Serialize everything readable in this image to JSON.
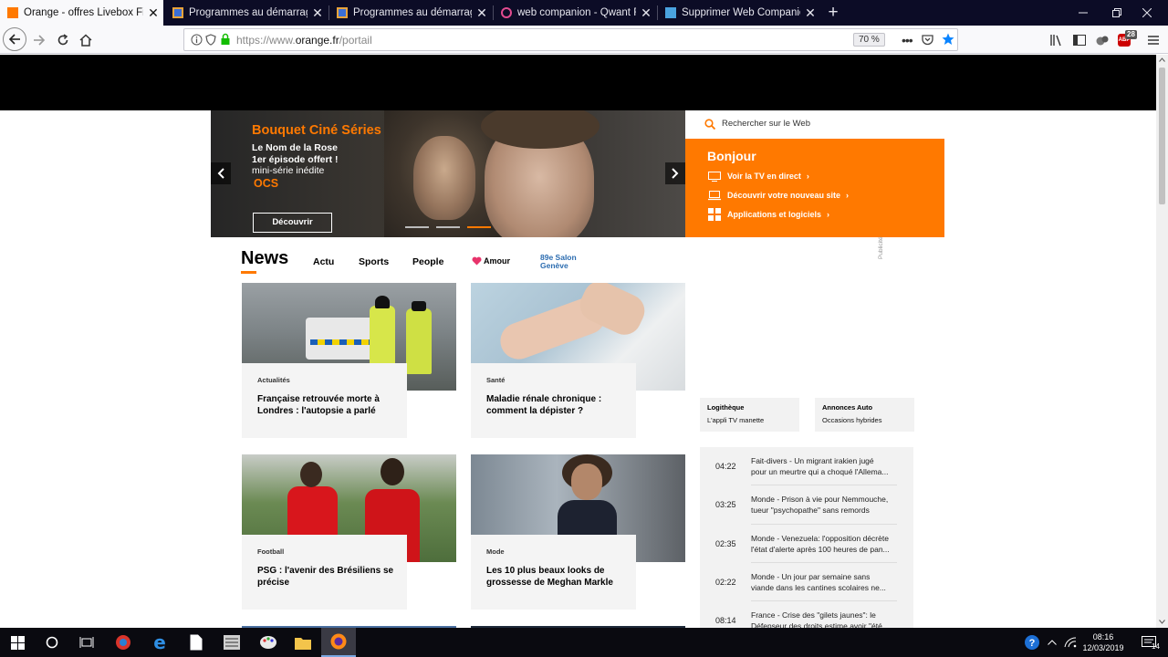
{
  "browser": {
    "tabs": [
      {
        "title": "Orange - offres Livebox Fibre et",
        "active": true,
        "favicon": "orange-logo-icon"
      },
      {
        "title": "Programmes au démarrage du",
        "active": false,
        "favicon": "app-icon"
      },
      {
        "title": "Programmes au démarrage du",
        "active": false,
        "favicon": "app-icon"
      },
      {
        "title": "web companion - Qwant Reche",
        "active": false,
        "favicon": "qwant-icon"
      },
      {
        "title": "Supprimer Web Companion - C",
        "active": false,
        "favicon": "bookmark-icon"
      }
    ],
    "url_prefix": "https://www.",
    "url_host": "orange.fr",
    "url_path": "/portail",
    "zoom": "70 %",
    "badge_count": "28",
    "badge_label": "ABP"
  },
  "hero": {
    "title": "Bouquet Ciné Séries",
    "line1": "Le Nom de la Rose",
    "line2": "1er épisode offert !",
    "line3": "mini-série inédite",
    "logo": "OCS",
    "button": "Découvrir",
    "active_slide": 3
  },
  "search": {
    "placeholder": "Rechercher sur le Web"
  },
  "bonjour": {
    "title": "Bonjour",
    "links": [
      {
        "label": "Voir la TV en direct",
        "icon": "tv-icon"
      },
      {
        "label": "Découvrir votre nouveau site",
        "icon": "laptop-icon"
      },
      {
        "label": "Applications et logiciels",
        "icon": "apps-grid-icon"
      }
    ]
  },
  "news": {
    "title": "News",
    "nav": [
      "Actu",
      "Sports",
      "People",
      "Amour"
    ],
    "salon_label_top": "89e Salon",
    "salon_label_bottom": "Genève",
    "cards": [
      {
        "category": "Actualités",
        "title": "Française retrouvée morte à Londres : l'autopsie a parlé"
      },
      {
        "category": "Santé",
        "title": "Maladie rénale chronique : comment la dépister ?"
      },
      {
        "category": "Football",
        "title": "PSG : l'avenir des Brésiliens se précise"
      },
      {
        "category": "Mode",
        "title": "Les 10 plus beaux looks de grossesse de Meghan Markle"
      }
    ]
  },
  "ad_label": "Publicité",
  "promos": [
    {
      "title": "Logithèque",
      "subtitle": "L'appli TV manette"
    },
    {
      "title": "Annonces Auto",
      "subtitle": "Occasions hybrides"
    }
  ],
  "flash": [
    {
      "time": "04:22",
      "line1": "Fait-divers - Un migrant irakien jugé",
      "line2": "pour un meurtre qui a choqué l'Allema..."
    },
    {
      "time": "03:25",
      "line1": "Monde - Prison à vie pour Nemmouche,",
      "line2": "tueur \"psychopathe\" sans remords"
    },
    {
      "time": "02:35",
      "line1": "Monde - Venezuela: l'opposition décrète",
      "line2": "l'état d'alerte après 100 heures de pan..."
    },
    {
      "time": "02:22",
      "line1": "Monde - Un jour par semaine sans",
      "line2": "viande dans les cantines scolaires ne..."
    },
    {
      "time": "08:14",
      "line1": "France - Crise des \"gilets jaunes\": le",
      "line2": "Défenseur des droits estime avoir \"été..."
    }
  ],
  "taskbar": {
    "time": "08:16",
    "date": "12/03/2019",
    "notifications": "14"
  },
  "colors": {
    "accent": "#ff7900",
    "tabbar": "#0c0c26",
    "taskbar": "#0a0a10"
  }
}
